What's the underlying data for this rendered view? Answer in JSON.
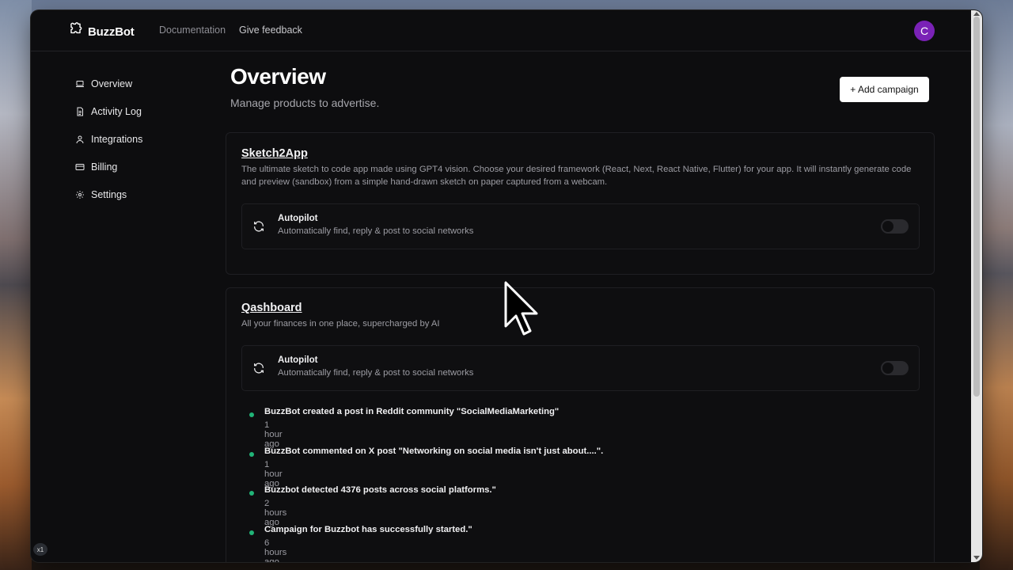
{
  "app": {
    "name": "BuzzBot",
    "nav": [
      "Documentation",
      "Give feedback"
    ],
    "avatar_initial": "C"
  },
  "sidebar": {
    "items": [
      {
        "label": "Overview",
        "icon": "laptop-icon"
      },
      {
        "label": "Activity Log",
        "icon": "document-icon"
      },
      {
        "label": "Integrations",
        "icon": "user-icon"
      },
      {
        "label": "Billing",
        "icon": "credit-card-icon"
      },
      {
        "label": "Settings",
        "icon": "gear-icon"
      }
    ]
  },
  "main": {
    "title": "Overview",
    "subtitle": "Manage products to advertise.",
    "add_button": "+ Add campaign",
    "campaigns": [
      {
        "name": "Sketch2App",
        "description": "The ultimate sketch to code app made using GPT4 vision. Choose your desired framework (React, Next, React Native, Flutter) for your app. It will instantly generate code and preview (sandbox) from a simple hand-drawn sketch on paper captured from a webcam.",
        "autopilot": {
          "title": "Autopilot",
          "description": "Automatically find, reply & post to social networks",
          "enabled": false
        }
      },
      {
        "name": "Qashboard",
        "description": "All your finances in one place, supercharged by AI",
        "autopilot": {
          "title": "Autopilot",
          "description": "Automatically find, reply & post to social networks",
          "enabled": false
        },
        "activity": [
          {
            "text": "BuzzBot created a post in Reddit community \"SocialMediaMarketing\"",
            "time": "1 hour ago"
          },
          {
            "text": "BuzzBot commented on X post \"Networking on social media isn't just about....\".",
            "time": "1 hour ago"
          },
          {
            "text": "Buzzbot detected 4376 posts across social platforms.\"",
            "time": "2 hours ago"
          },
          {
            "text": "Campaign for Buzzbot has successfully started.\"",
            "time": "6 hours ago"
          }
        ]
      }
    ]
  },
  "overlay": {
    "zoom_badge": "x1"
  },
  "colors": {
    "background": "#0d0d0f",
    "avatar": "#7a22b6",
    "activity_dot": "#21b478",
    "button": "#ffffff"
  }
}
